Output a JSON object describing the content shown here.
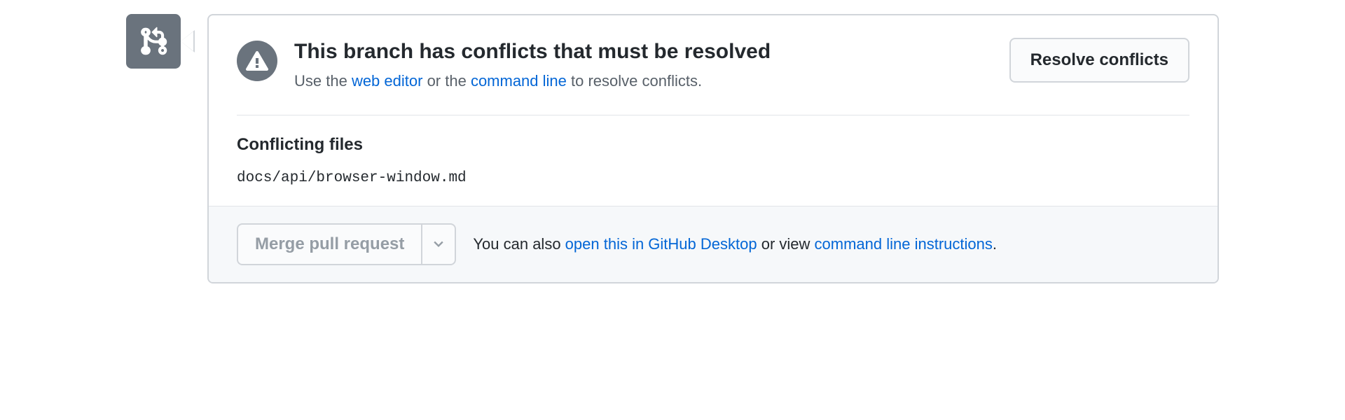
{
  "conflict": {
    "title": "This branch has conflicts that must be resolved",
    "subtitle_pre": "Use the ",
    "subtitle_link1": "web editor",
    "subtitle_mid": " or the ",
    "subtitle_link2": "command line",
    "subtitle_post": " to resolve conflicts.",
    "resolve_button": "Resolve conflicts"
  },
  "files": {
    "heading": "Conflicting files",
    "items": [
      "docs/api/browser-window.md"
    ]
  },
  "footer": {
    "merge_button": "Merge pull request",
    "text_pre": "You can also ",
    "link1": "open this in GitHub Desktop",
    "text_mid": " or view ",
    "link2": "command line instructions",
    "text_post": "."
  }
}
